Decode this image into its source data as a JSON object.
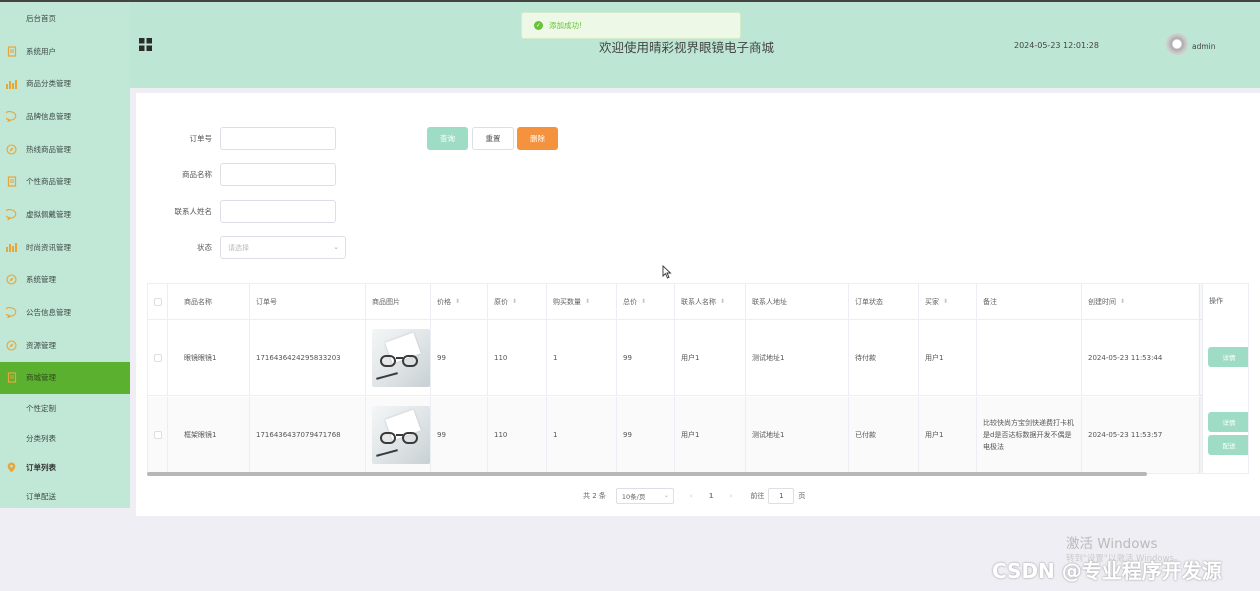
{
  "sidebar": {
    "items": [
      {
        "label": "后台首页",
        "icon": ""
      },
      {
        "label": "系统用户",
        "icon": "document-icon"
      },
      {
        "label": "商品分类管理",
        "icon": "bar-chart-icon"
      },
      {
        "label": "品牌信息管理",
        "icon": "chat-bubble-icon"
      },
      {
        "label": "热线商品管理",
        "icon": "compass-icon"
      },
      {
        "label": "个性商品管理",
        "icon": "document-icon"
      },
      {
        "label": "虚拟佩戴管理",
        "icon": "chat-bubble-icon"
      },
      {
        "label": "时尚资讯管理",
        "icon": "bar-chart-icon"
      },
      {
        "label": "系统管理",
        "icon": "compass-icon"
      },
      {
        "label": "公告信息管理",
        "icon": "chat-bubble-icon"
      },
      {
        "label": "资源管理",
        "icon": "compass-icon"
      },
      {
        "label": "商城管理",
        "icon": "document-icon"
      }
    ],
    "sub_items": [
      {
        "label": "个性定制"
      },
      {
        "label": "分类列表"
      },
      {
        "label": "订单列表",
        "icon": "location-pin-icon"
      },
      {
        "label": "订单配送"
      }
    ]
  },
  "header": {
    "title": "欢迎使用晴彩视界眼镜电子商城",
    "datetime": "2024-05-23 12:01:28",
    "username": "admin"
  },
  "toast": {
    "message": "添加成功!"
  },
  "filters": {
    "order_no_label": "订单号",
    "product_name_label": "商品名称",
    "contact_name_label": "联系人姓名",
    "status_label": "状态",
    "status_placeholder": "请选择",
    "query": "查询",
    "reset": "重置",
    "delete": "删除"
  },
  "table": {
    "headers": [
      "商品名称",
      "订单号",
      "商品图片",
      "价格",
      "原价",
      "购买数量",
      "总价",
      "联系人名称",
      "联系人地址",
      "订单状态",
      "买家",
      "备注",
      "创建时间",
      "操作"
    ],
    "rows": [
      {
        "name": "眼镜眼镜1",
        "order_no": "1716436424295833203",
        "price": "99",
        "original_price": "110",
        "quantity": "1",
        "total": "99",
        "contact_name": "用户1",
        "contact_address": "测试地址1",
        "status": "待付款",
        "buyer": "用户1",
        "remark": "",
        "created": "2024-05-23 11:53:44",
        "actions": [
          "详情"
        ]
      },
      {
        "name": "框架眼镜1",
        "order_no": "1716436437079471768",
        "price": "99",
        "original_price": "110",
        "quantity": "1",
        "total": "99",
        "contact_name": "用户1",
        "contact_address": "测试地址1",
        "status": "已付款",
        "buyer": "用户1",
        "remark": "比较快尚方宝剑快递费打卡机是d是否达标数据开发不偶是电极法",
        "created": "2024-05-23 11:53:57",
        "actions": [
          "详情",
          "配送"
        ]
      }
    ]
  },
  "pagination": {
    "total": "共 2 条",
    "page_size": "10条/页",
    "current": "1",
    "goto_label": "前往",
    "goto_value": "1",
    "page_suffix": "页",
    "prev": "‹",
    "next": "›"
  },
  "overlay": {
    "activate_windows": "激活 Windows",
    "activate_hint": "转到\"设置\"以激活 Windows。",
    "csdn": "CSDN @专业程序开发源"
  },
  "colors": {
    "sidebar_bg": "#c1e7d6",
    "active_menu": "#5bb030",
    "primary_button": "#9fdcc6",
    "delete_button": "#f5923e",
    "icon_orange": "#e8a53a"
  }
}
